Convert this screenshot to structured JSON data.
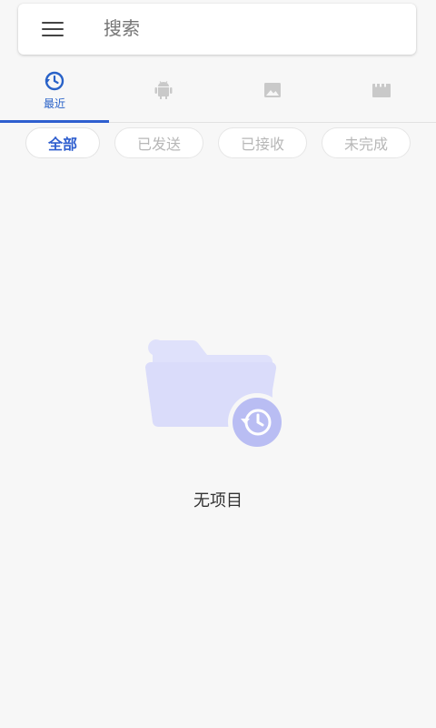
{
  "search": {
    "placeholder": "搜索"
  },
  "tabs": [
    {
      "icon": "history-icon",
      "label": "最近",
      "active": true
    },
    {
      "icon": "android-icon",
      "label": ""
    },
    {
      "icon": "image-icon",
      "label": ""
    },
    {
      "icon": "video-icon",
      "label": ""
    }
  ],
  "filters": [
    {
      "label": "全部",
      "active": true
    },
    {
      "label": "已发送"
    },
    {
      "label": "已接收"
    },
    {
      "label": "未完成"
    }
  ],
  "empty_state": {
    "message": "无项目",
    "icon": "empty-folder-history-icon"
  },
  "colors": {
    "accent": "#2f5fcf",
    "icon_gray": "#c9c9c9",
    "illustration": "#dfe1fb"
  }
}
